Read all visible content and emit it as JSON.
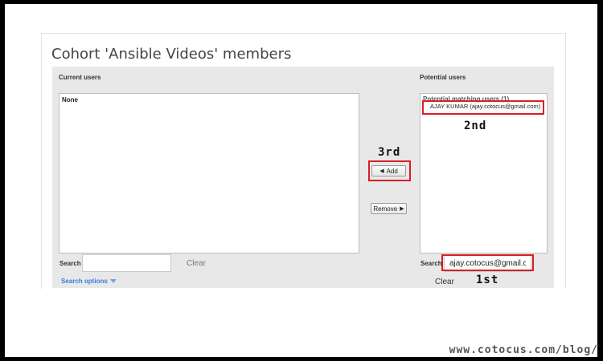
{
  "page": {
    "title": "Cohort 'Ansible Videos' members"
  },
  "current_users": {
    "heading": "Current users",
    "items": [
      "None"
    ],
    "search_label": "Search",
    "search_value": "",
    "clear_label": "Clear",
    "search_options_label": "Search options"
  },
  "potential_users": {
    "heading": "Potential users",
    "group_label": "Potential matching users (1)",
    "items": [
      "AJAY KUMAR (ajay.cotocus@gmail.com)"
    ],
    "search_label": "Search",
    "search_value": "ajay.cotocus@gmail.co",
    "clear_label": "Clear"
  },
  "buttons": {
    "add_label": "Add",
    "add_icon": "left-triangle",
    "remove_label": "Remove",
    "remove_icon": "right-triangle"
  },
  "annotations": {
    "first": "1st",
    "second": "2nd",
    "third": "3rd",
    "highlight_color": "#d81f26"
  },
  "watermark": "www.cotocus.com/blog/"
}
